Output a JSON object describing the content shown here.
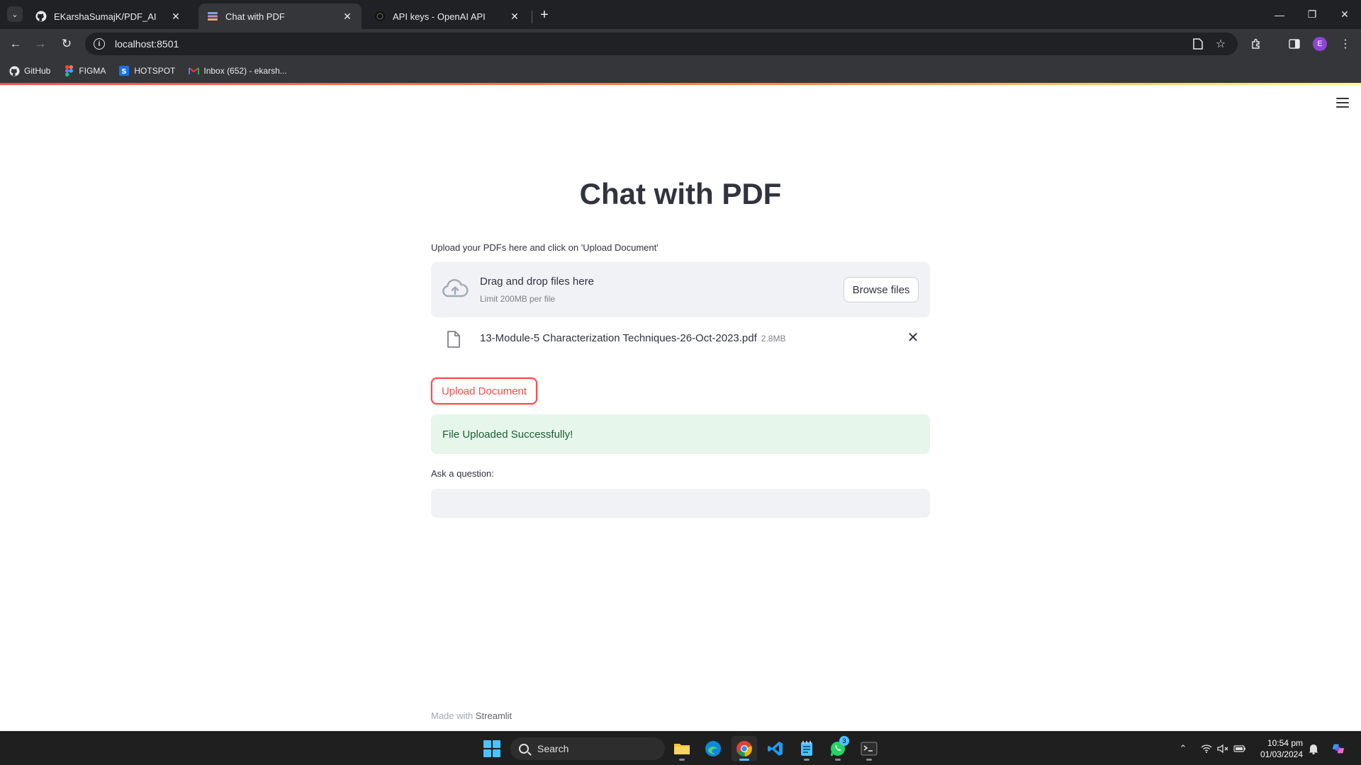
{
  "browser": {
    "tabs": [
      {
        "title": "EKarshaSumajK/PDF_AI",
        "favicon": "github-icon"
      },
      {
        "title": "Chat with PDF",
        "favicon": "streamlit-icon"
      },
      {
        "title": "API keys - OpenAI API",
        "favicon": "openai-icon"
      }
    ],
    "address": "localhost:8501",
    "bookmarks": [
      {
        "label": "GitHub",
        "icon": "github-icon"
      },
      {
        "label": "FIGMA",
        "icon": "figma-icon"
      },
      {
        "label": "HOTSPOT",
        "icon": "hotspot-icon"
      },
      {
        "label": "Inbox (652) - ekarsh...",
        "icon": "gmail-icon"
      }
    ],
    "profile_initial": "E"
  },
  "page": {
    "title": "Chat with PDF",
    "upload_label": "Upload your PDFs here and click on 'Upload Document'",
    "dropzone": {
      "title": "Drag and drop files here",
      "limit": "Limit 200MB per file",
      "browse_label": "Browse files"
    },
    "file": {
      "name": "13-Module-5 Characterization Techniques-26-Oct-2023.pdf",
      "size": "2.8MB"
    },
    "upload_button": "Upload Document",
    "success_message": "File Uploaded Successfully!",
    "question_label": "Ask a question:",
    "question_value": "",
    "footer_prefix": "Made with",
    "footer_brand": "Streamlit"
  },
  "taskbar": {
    "search_label": "Search",
    "whatsapp_badge": "3",
    "time": "10:54 pm",
    "date": "01/03/2024"
  },
  "colors": {
    "accent": "#ff4b4b",
    "success_bg": "#e6f6ea",
    "success_text": "#1b5e36",
    "text": "#31333f"
  }
}
